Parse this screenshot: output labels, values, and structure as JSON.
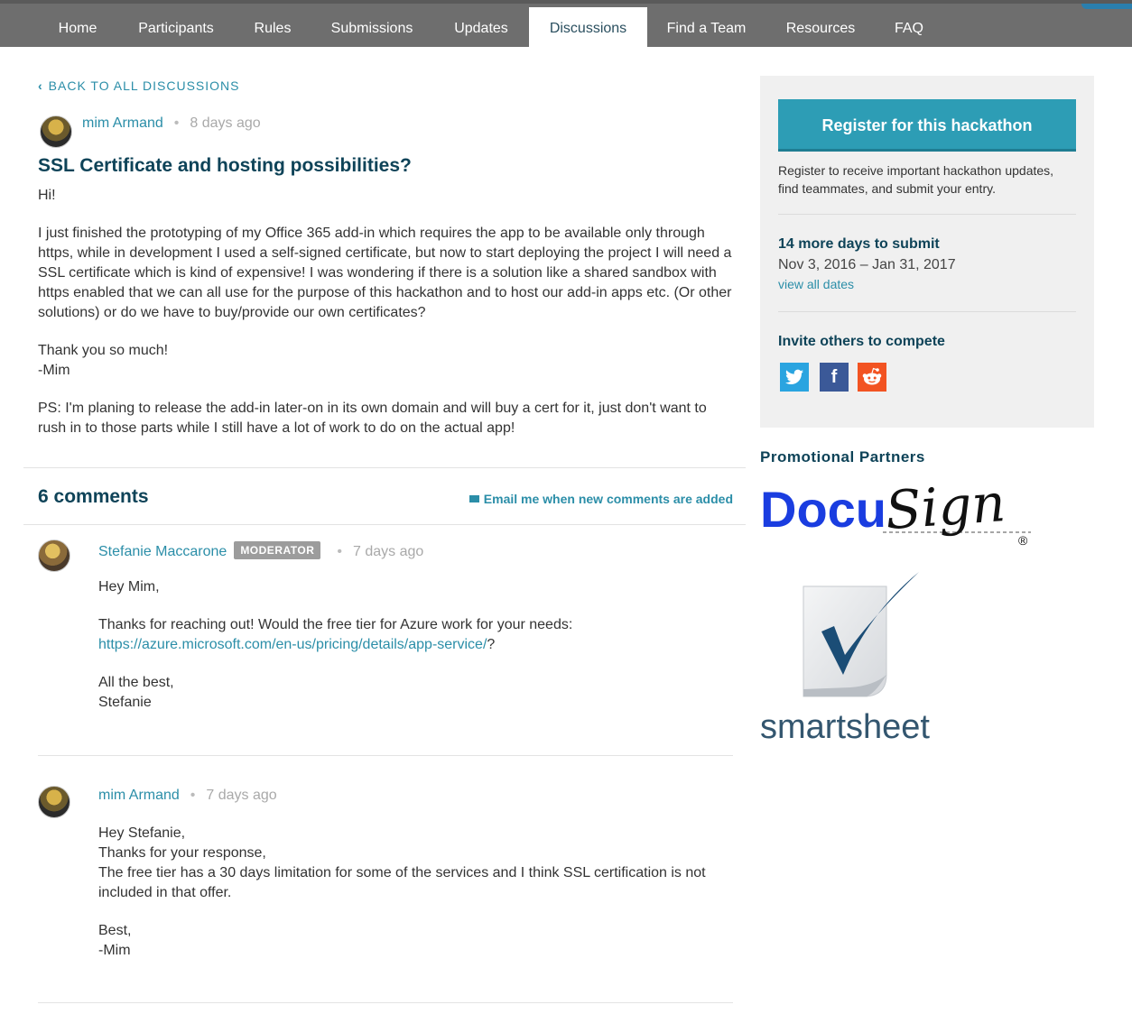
{
  "nav": {
    "items": [
      {
        "label": "Home"
      },
      {
        "label": "Participants"
      },
      {
        "label": "Rules"
      },
      {
        "label": "Submissions"
      },
      {
        "label": "Updates"
      },
      {
        "label": "Discussions",
        "active": true
      },
      {
        "label": "Find a Team"
      },
      {
        "label": "Resources"
      },
      {
        "label": "FAQ"
      }
    ]
  },
  "back_link": "BACK TO ALL DISCUSSIONS",
  "post": {
    "author": "mim Armand",
    "time": "8 days ago",
    "title": "SSL Certificate and hosting possibilities?",
    "paragraphs": [
      "Hi!",
      "I just finished the prototyping of my Office 365 add-in which requires the app to be available only through https, while in development I used a self-signed certificate, but now to start deploying the project I will need a SSL certificate which is kind of expensive! I was wondering if there is a solution like a shared sandbox with https enabled that we can all use for the purpose of this hackathon and to host our add-in apps etc. (Or other solutions) or do we have to buy/provide our own certificates?",
      "Thank you so much!",
      "-Mim",
      "PS: I'm planing to release the add-in later-on in its own domain and will buy a cert for it, just don't want to rush in to those parts while I still have a lot of work to do on the actual app!"
    ]
  },
  "comments_header": {
    "count_label": "6 comments",
    "email_label": "Email me when new comments are added"
  },
  "comments": [
    {
      "author": "Stefanie Maccarone",
      "badge": "MODERATOR",
      "time": "7 days ago",
      "greeting": "Hey Mim,",
      "body_before_link": "Thanks for reaching out! Would the free tier for Azure work for your needs:",
      "link": "https://azure.microsoft.com/en-us/pricing/details/app-service/",
      "after_link": "?",
      "signoff_1": "All the best,",
      "signoff_2": "Stefanie"
    },
    {
      "author": "mim Armand",
      "time": "7 days ago",
      "line_1": "Hey Stefanie,",
      "line_2": "Thanks for your response,",
      "line_3": "The free tier has a 30 days limitation for some of the services and I think SSL certification is not included in that offer.",
      "signoff_1": "Best,",
      "signoff_2": "-Mim"
    }
  ],
  "sidebar": {
    "register_label": "Register for this hackathon",
    "register_text": "Register to receive important hackathon updates, find teammates, and submit your entry.",
    "days_left": "14 more days to submit",
    "dates": "Nov 3, 2016 – Jan 31, 2017",
    "view_dates": "view all dates",
    "invite_heading": "Invite others to compete",
    "social": [
      "twitter-icon",
      "facebook-icon",
      "reddit-icon"
    ]
  },
  "partners": {
    "title": "Promotional Partners",
    "docusign_a": "Docu",
    "docusign_b": "Sign",
    "registered": "®",
    "smartsheet": "smartsheet"
  },
  "colors": {
    "nav_bg": "#6e6e6e",
    "accent": "#2b8ea8",
    "heading": "#0e4358",
    "register_bg": "#2d9db5",
    "docusign_blue": "#1a3de0"
  }
}
